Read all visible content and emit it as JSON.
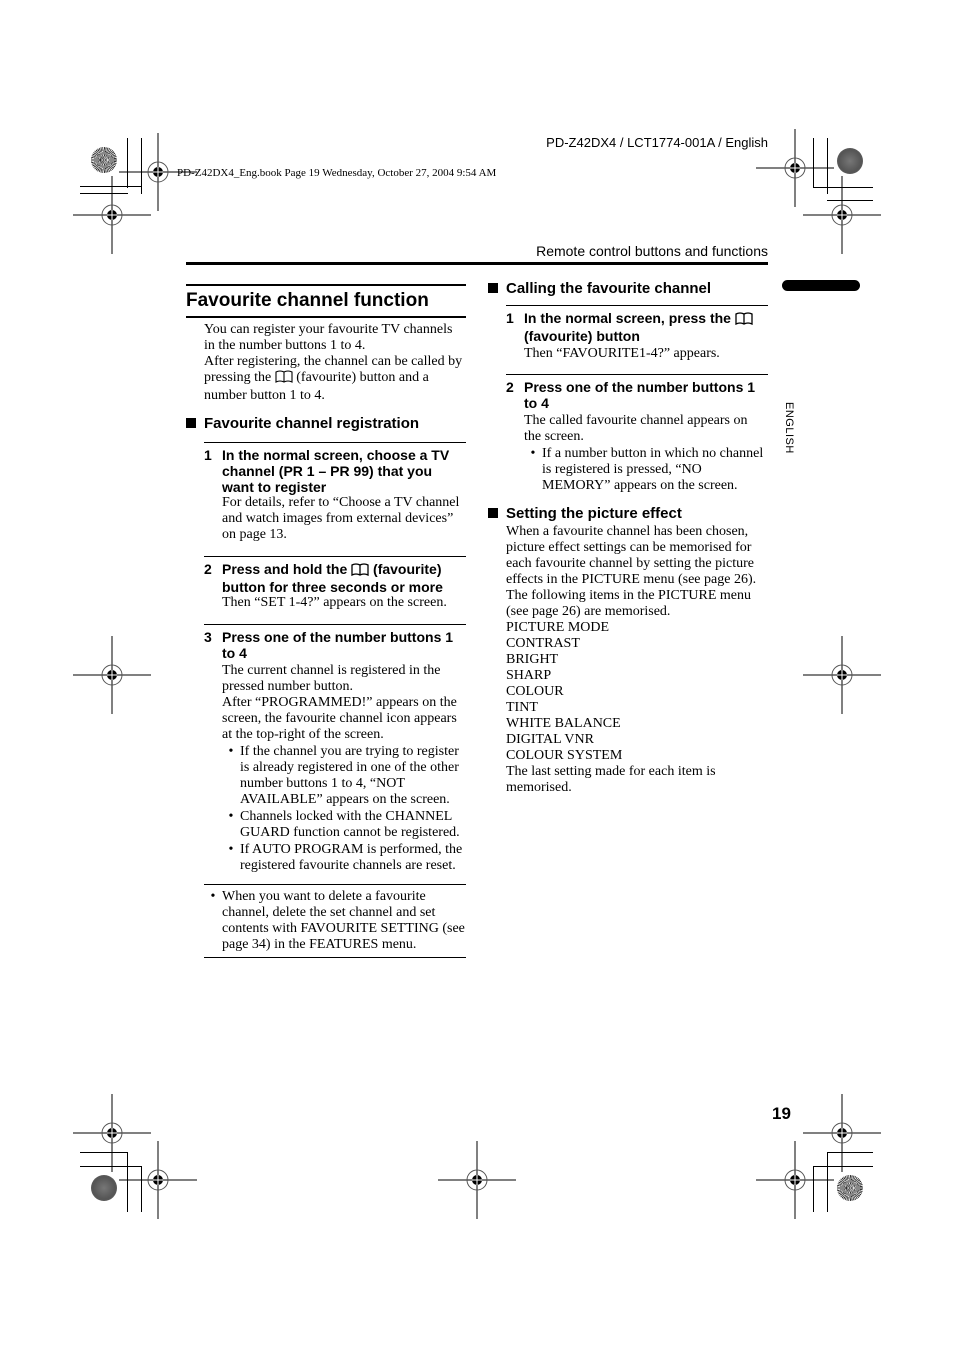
{
  "header": {
    "doc_id": "PD-Z42DX4 / LCT1774-001A / English",
    "book_stamp": "PD-Z42DX4_Eng.book  Page 19  Wednesday, October 27, 2004  9:54 AM",
    "running_head": "Remote control buttons and functions"
  },
  "side_tab": {
    "language": "ENGLISH"
  },
  "page_number": "19",
  "left_column": {
    "title": "Favourite channel function",
    "intro": [
      "You can register your favourite TV channels in the number buttons 1 to 4.",
      "After registering, the channel can be called by pressing the",
      "(favourite) button and a number button 1 to 4."
    ],
    "registration": {
      "heading": "Favourite channel registration",
      "steps": [
        {
          "num": "1",
          "title": "In the normal screen, choose a TV channel (PR 1 – PR 99) that you want to register",
          "body": "For details, refer to “Choose a TV channel and watch images from external devices” on page 13."
        },
        {
          "num": "2",
          "title_pre": "Press and hold the",
          "title_post": "(favourite) button for three seconds or more",
          "body": "Then “SET 1-4?” appears on the screen."
        },
        {
          "num": "3",
          "title": "Press one of the number buttons 1 to 4",
          "body": [
            "The current channel is registered in the pressed number button.",
            "After “PROGRAMMED!” appears on the screen, the favourite channel icon appears at the top-right of the screen."
          ],
          "bullets": [
            "If the channel you are trying to register is already registered in one of the other number buttons 1 to 4, “NOT AVAILABLE” appears on the screen.",
            "Channels locked with the CHANNEL GUARD function cannot be registered.",
            "If AUTO PROGRAM is performed, the registered favourite channels are reset."
          ]
        }
      ],
      "note": "When you want to delete a favourite channel, delete the set channel and set contents with FAVOURITE SETTING (see page 34) in the FEATURES menu."
    }
  },
  "right_column": {
    "calling": {
      "heading": "Calling the favourite channel",
      "steps": [
        {
          "num": "1",
          "title_pre": "In the normal screen, press the",
          "title_post": "(favourite) button",
          "body": "Then “FAVOURITE1-4?” appears."
        },
        {
          "num": "2",
          "title": "Press one of the number buttons 1 to 4",
          "body": "The called favourite channel appears on the screen.",
          "bullets": [
            "If a number button in which no channel is registered is pressed, “NO MEMORY” appears on the screen."
          ]
        }
      ]
    },
    "picture_effect": {
      "heading": "Setting the picture effect",
      "body": "When a favourite channel has been chosen, picture effect settings can be memorised for each favourite channel by setting the picture effects in the PICTURE menu (see page 26). The following items in the PICTURE menu (see page 26) are memorised.",
      "items": [
        "PICTURE MODE",
        "CONTRAST",
        "BRIGHT",
        "SHARP",
        "COLOUR",
        "TINT",
        "WHITE BALANCE",
        "DIGITAL VNR",
        "COLOUR SYSTEM"
      ],
      "footer": "The last setting made for each item is memorised."
    }
  }
}
